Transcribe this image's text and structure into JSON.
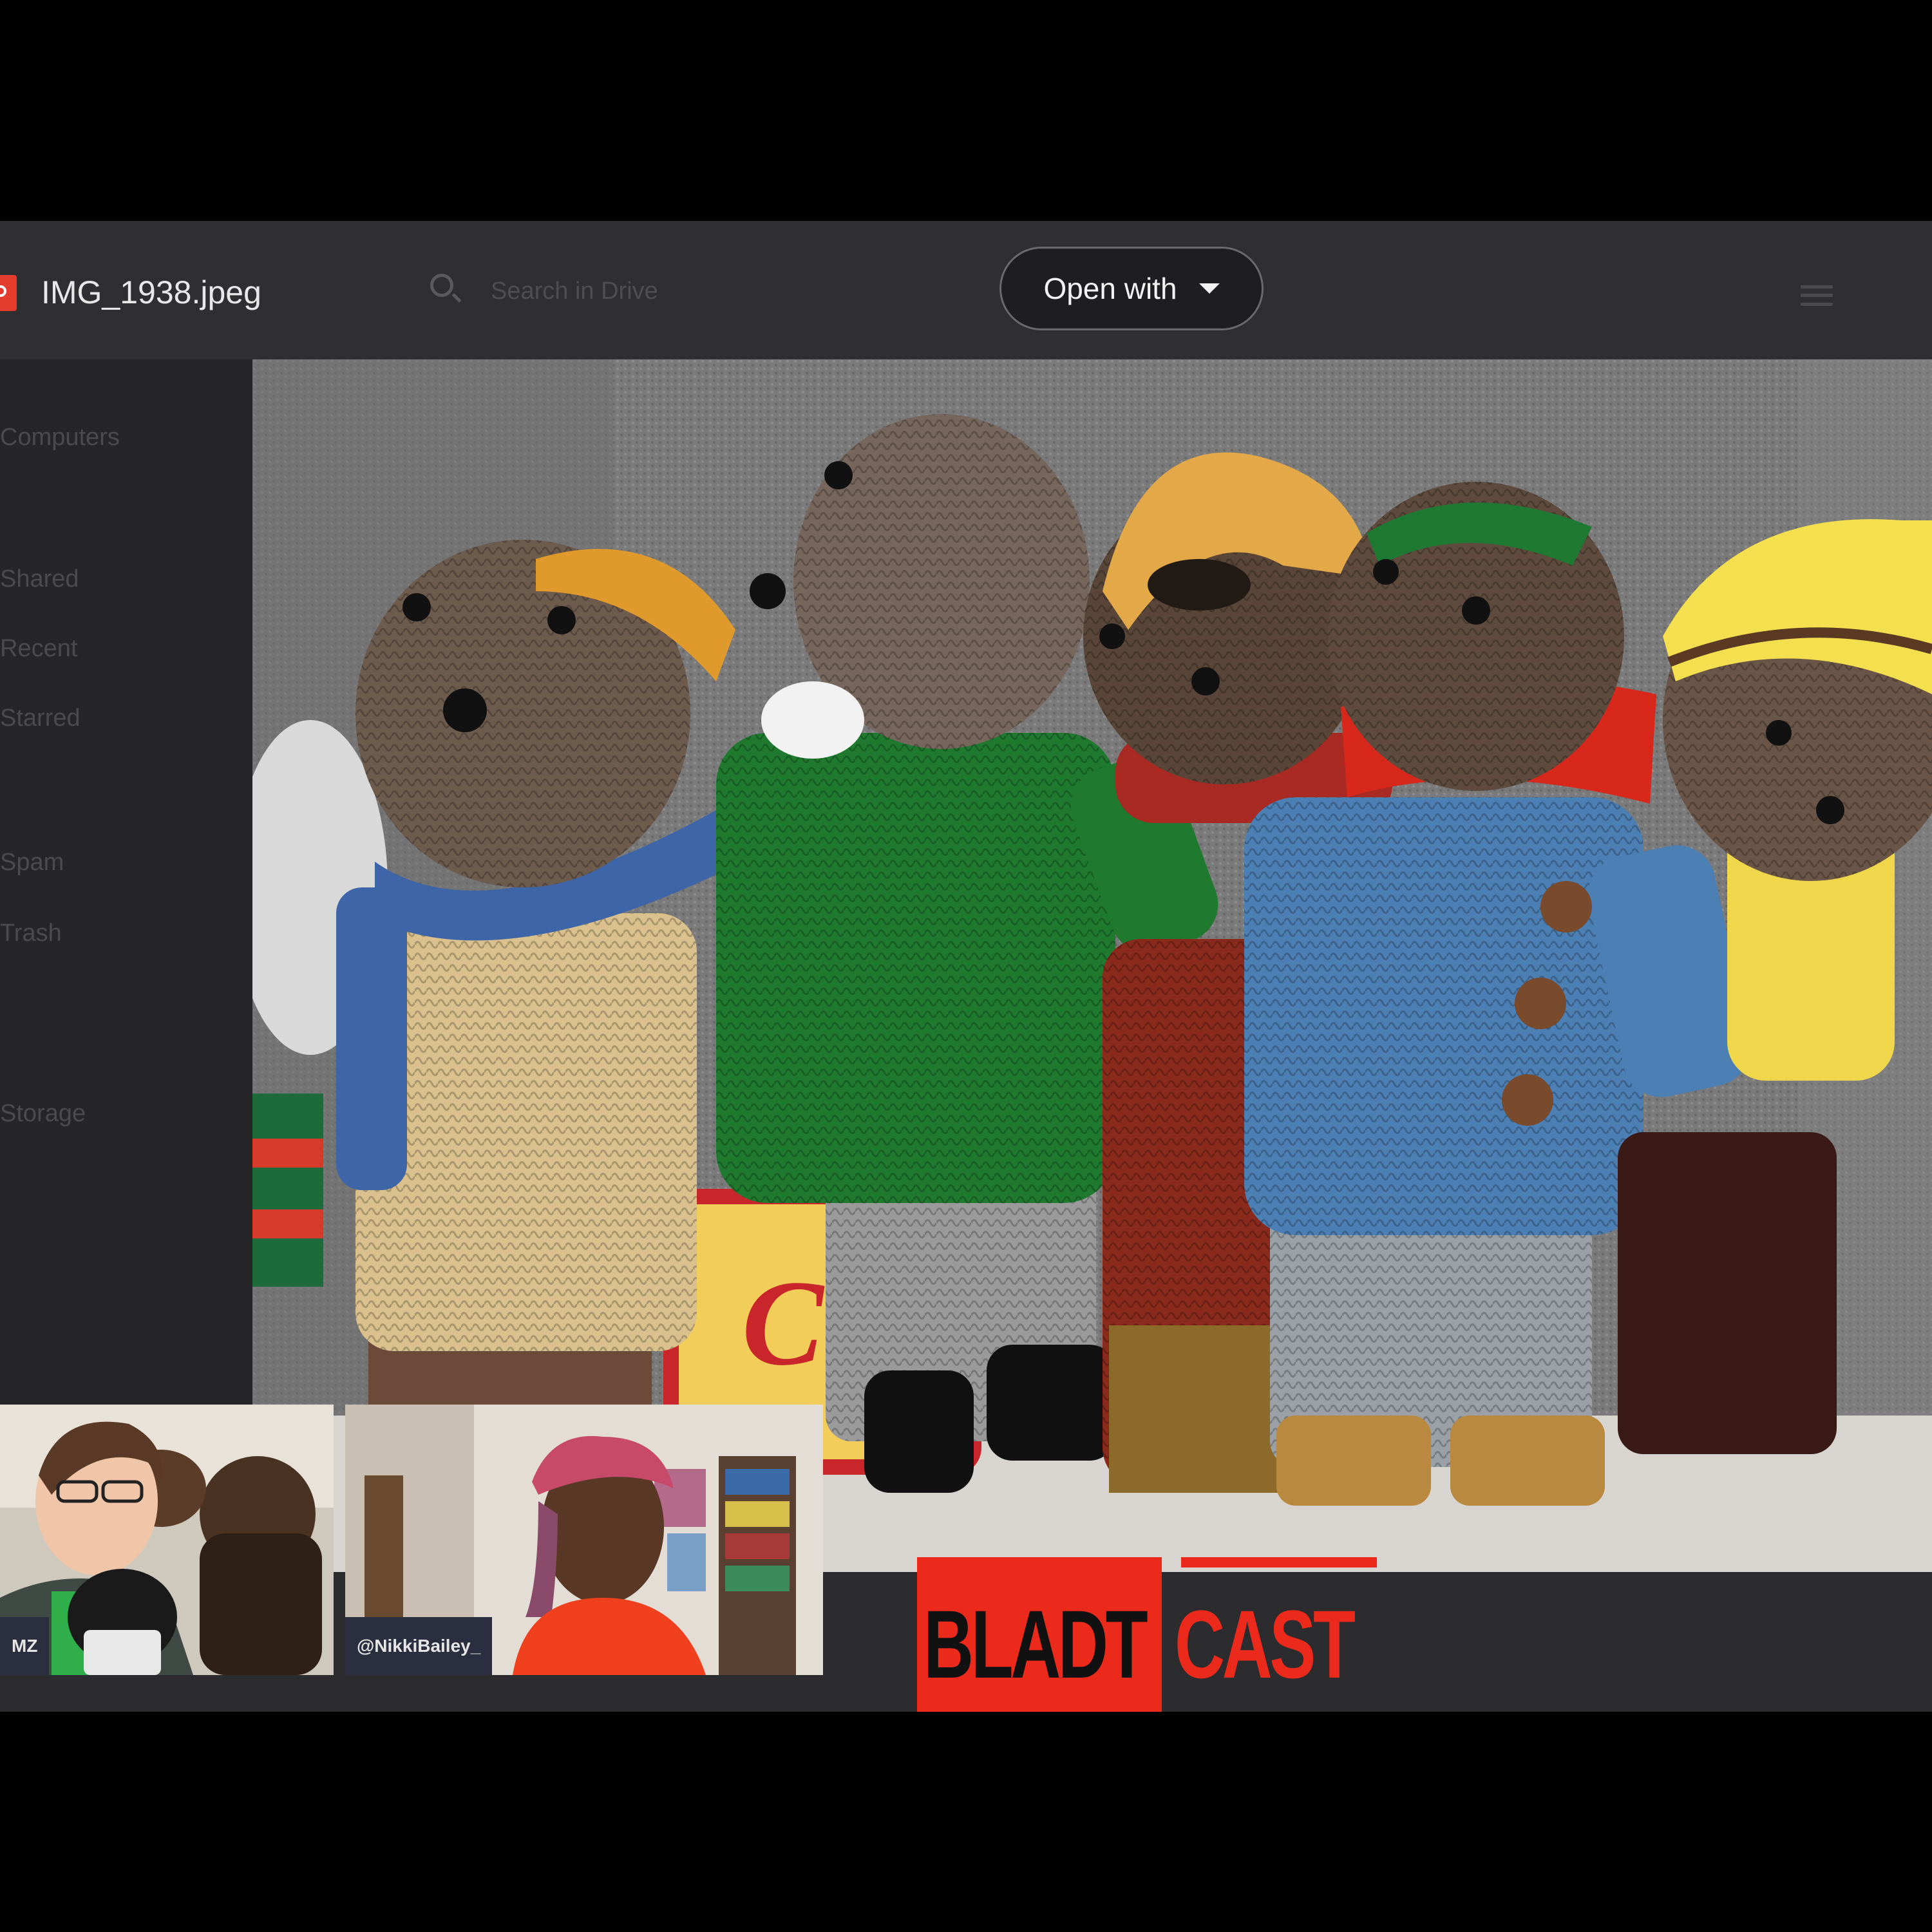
{
  "toolbar": {
    "file_name": "IMG_1938.jpeg",
    "search_placeholder": "Search in Drive",
    "open_with_label": "Open with"
  },
  "sidebar": {
    "items": [
      "Computers",
      "Shared",
      "Recent",
      "Starred",
      "Spam",
      "Trash",
      "Storage"
    ]
  },
  "photo": {
    "pillow_text": "Ch"
  },
  "participants": [
    {
      "name": "MZ"
    },
    {
      "name": "@NikkiBailey_"
    }
  ],
  "logo": {
    "left": "BLADT",
    "right": "CAST"
  },
  "colors": {
    "background": "#000000",
    "app": "#2c2c2e",
    "brand_red": "#ec2a1c"
  }
}
